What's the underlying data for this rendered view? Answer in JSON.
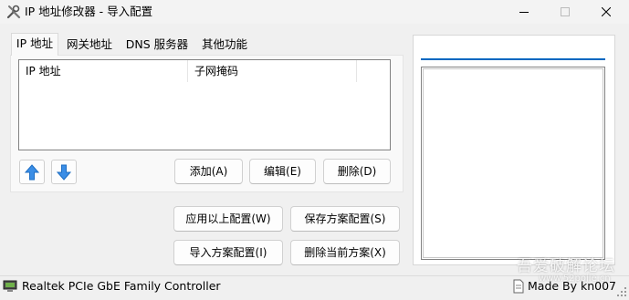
{
  "window": {
    "title": "IP 地址修改器 - 导入配置",
    "controls": [
      "minimize",
      "maximize",
      "close"
    ]
  },
  "tabs": [
    {
      "label": "IP 地址",
      "active": true
    },
    {
      "label": "网关地址",
      "active": false
    },
    {
      "label": "DNS 服务器",
      "active": false
    },
    {
      "label": "其他功能",
      "active": false
    }
  ],
  "ip_list": {
    "columns": [
      "IP 地址",
      "子网掩码"
    ],
    "rows": []
  },
  "list_buttons": {
    "up_icon": "arrow-up-icon",
    "down_icon": "arrow-down-icon",
    "add": "添加(A)",
    "edit": "编辑(E)",
    "delete": "删除(D)"
  },
  "scheme_buttons": {
    "apply": "应用以上配置(W)",
    "save": "保存方案配置(S)",
    "import": "导入方案配置(I)",
    "delete_scheme": "删除当前方案(X)"
  },
  "scheme_panel": {
    "name_value": "",
    "schemes": []
  },
  "statusbar": {
    "adapter": "Realtek PCIe GbE Family Controller",
    "author": "Made By kn007"
  },
  "watermark": {
    "text": "吾爱破解论坛",
    "url": "www.52pojie.cn"
  },
  "colors": {
    "accent": "#0067c0",
    "arrow_blue": "#3b8ee6",
    "window_bg": "#f0f0f0"
  }
}
